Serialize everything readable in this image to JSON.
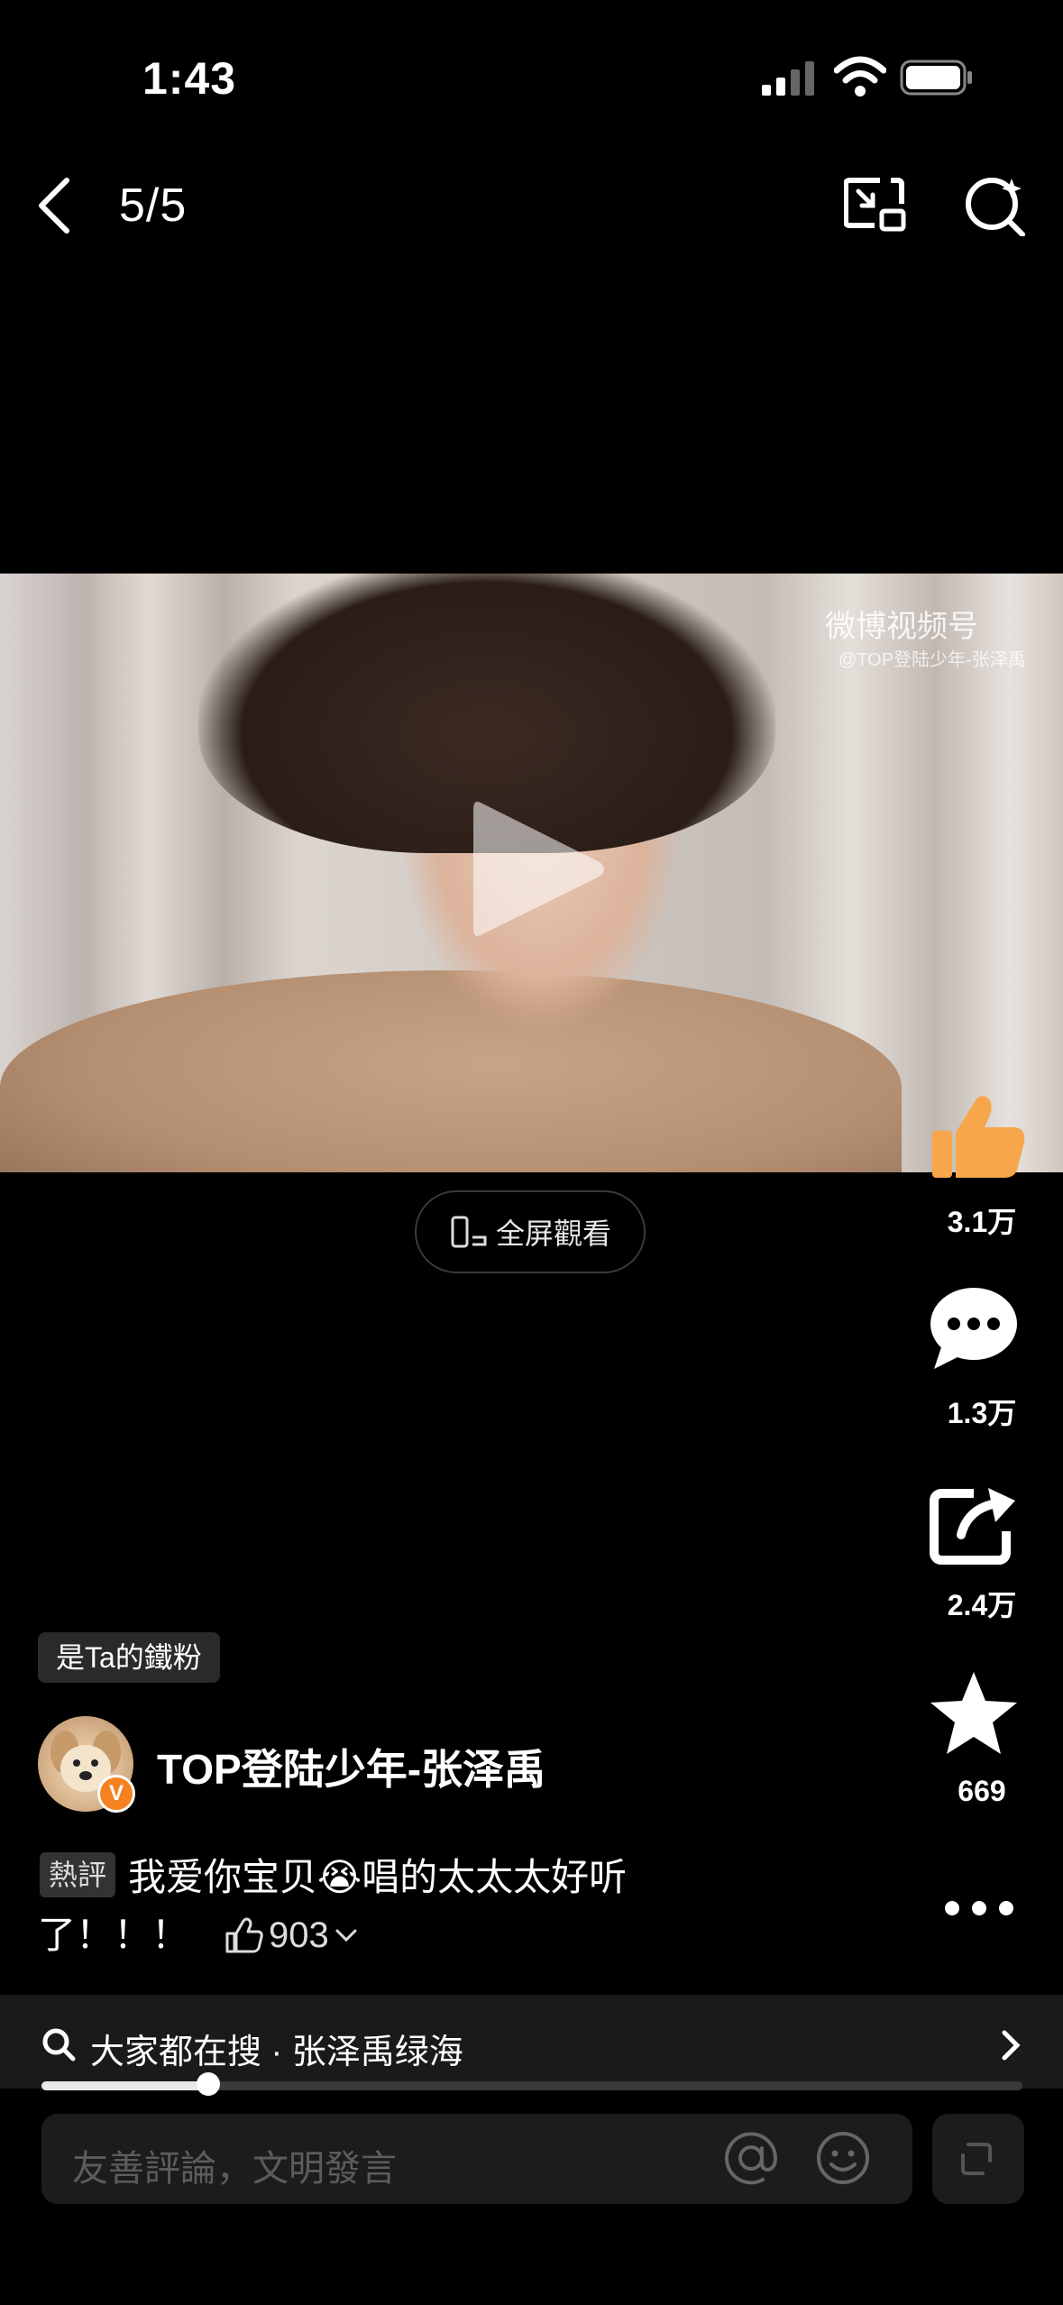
{
  "status_bar": {
    "time": "1:43"
  },
  "nav": {
    "counter": "5/5"
  },
  "video": {
    "watermark_logo": "微博视频号",
    "watermark_sub": "@TOP登陆少年-张泽禹"
  },
  "fullscreen_label": "全屏觀看",
  "actions": {
    "like_count": "3.1万",
    "comment_count": "1.3万",
    "share_count": "2.4万",
    "favorite_count": "669"
  },
  "fan_badge": "是Ta的鐵粉",
  "author": {
    "name": "TOP登陆少年-张泽禹",
    "verified": "V"
  },
  "hot_comment": {
    "tag": "熱評",
    "text_line1": "我爱你宝贝😭唱的太太太好听",
    "text_line2": "了！！！",
    "likes": "903"
  },
  "search_suggestion": {
    "text": "大家都在搜 · 张泽禹绿海"
  },
  "progress": {
    "fraction": 0.17
  },
  "comment_input": {
    "placeholder": "友善評論，文明發言"
  },
  "colors": {
    "accent_orange": "#f58220",
    "like_orange": "#f7a64b"
  }
}
